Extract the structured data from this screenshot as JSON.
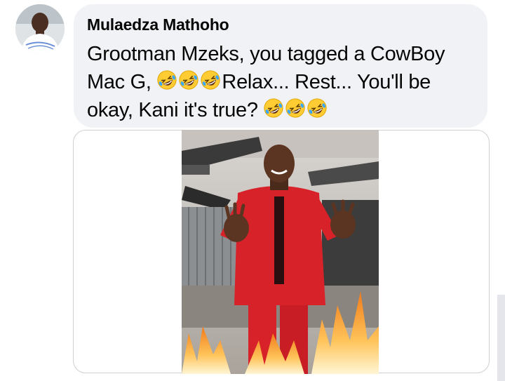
{
  "comment": {
    "author_name": "Mulaedza Mathoho",
    "segments": [
      {
        "type": "text",
        "value": "Grootman Mzeks, you tagged a CowBoy Mac G, "
      },
      {
        "type": "emoji",
        "name": "rolling-on-floor-laughing"
      },
      {
        "type": "emoji",
        "name": "rolling-on-floor-laughing"
      },
      {
        "type": "emoji",
        "name": "rolling-on-floor-laughing"
      },
      {
        "type": "text",
        "value": "Relax... Rest... You'll be okay, Kani it's true? "
      },
      {
        "type": "emoji",
        "name": "rolling-on-floor-laughing"
      },
      {
        "type": "emoji",
        "name": "rolling-on-floor-laughing"
      },
      {
        "type": "emoji",
        "name": "rolling-on-floor-laughing"
      }
    ],
    "text_part_1": "Grootman Mzeks, you tagged a CowBoy Mac G, ",
    "text_part_2": "Relax... Rest... You'll be okay, Kani it's true? ",
    "avatar_icon": "profile-photo",
    "attachment_icon": "photo-man-red-tracksuit-flames"
  },
  "colors": {
    "bubble_bg": "#f0f2f5",
    "text": "#050505",
    "card_border": "#ced0d4",
    "tracksuit_red": "#d8222a",
    "flame_orange": "#f39a2a"
  }
}
